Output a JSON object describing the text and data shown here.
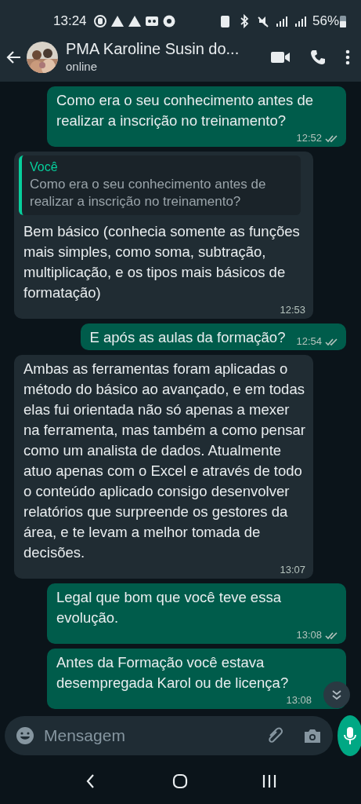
{
  "status_bar": {
    "time": "13:24",
    "battery": "56%"
  },
  "header": {
    "title": "PMA Karoline Susin do...",
    "subtitle": "online"
  },
  "messages": [
    {
      "kind": "outgoing",
      "text": "Como era o seu conhecimento antes de realizar a inscrição no treinamento?",
      "time": "12:52",
      "delivered": true
    },
    {
      "kind": "incoming",
      "quote": {
        "author": "Você",
        "text": "Como era o seu conhecimento antes de realizar a inscrição no treinamento?"
      },
      "text": "Bem básico (conhecia somente as funções mais simples, como soma, subtração, multiplicação, e os tipos mais básicos de formatação)",
      "time": "12:53"
    },
    {
      "kind": "outgoing",
      "text": "E após as aulas da formação?",
      "time": "12:54",
      "delivered": true
    },
    {
      "kind": "incoming",
      "text": "Ambas as ferramentas foram aplicadas o método do básico ao avançado, e em todas elas fui orientada não só apenas a mexer na ferramenta, mas também a como pensar como um analista de dados. Atualmente atuo apenas com o Excel e através de todo o conteúdo aplicado consigo desenvolver relatórios que surpreende os gestores da área, e te levam a melhor tomada de decisões.",
      "time": "13:07"
    },
    {
      "kind": "outgoing",
      "text": "Legal que bom que você teve essa evolução.",
      "time": "13:08",
      "delivered": true
    },
    {
      "kind": "outgoing",
      "text": "Antes da Formação você estava desempregada Karol ou de licença?",
      "time": "13:08"
    }
  ],
  "composer": {
    "placeholder": "Mensagem"
  }
}
